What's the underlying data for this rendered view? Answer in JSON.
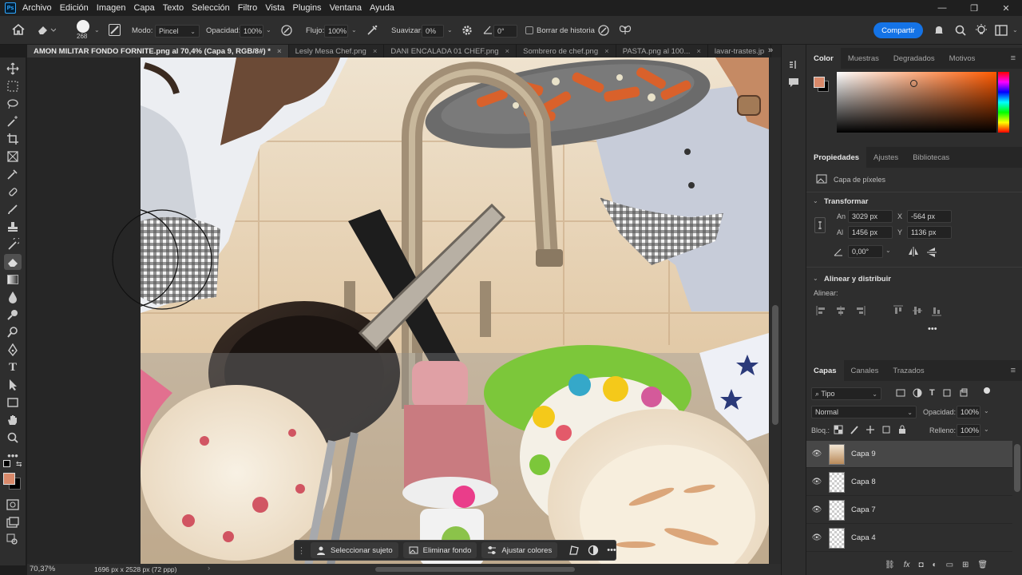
{
  "menu": {
    "items": [
      "Archivo",
      "Edición",
      "Imagen",
      "Capa",
      "Texto",
      "Selección",
      "Filtro",
      "Vista",
      "Plugins",
      "Ventana",
      "Ayuda"
    ]
  },
  "options": {
    "brush_size": "268",
    "mode_label": "Modo:",
    "mode_value": "Pincel",
    "opacity_label": "Opacidad:",
    "opacity_value": "100%",
    "flow_label": "Flujo:",
    "flow_value": "100%",
    "smooth_label": "Suavizar:",
    "smooth_value": "0%",
    "angle_value": "0°",
    "history_label": "Borrar de historia",
    "share_label": "Compartir"
  },
  "tabs": [
    {
      "label": "AMON MILITAR FONDO FORNITE.png al 70,4% (Capa 9, RGB/8#) *",
      "active": true
    },
    {
      "label": "Lesly Mesa Chef.png",
      "active": false
    },
    {
      "label": "DANI ENCALADA 01 CHEF.png",
      "active": false
    },
    {
      "label": "Sombrero de chef.png",
      "active": false
    },
    {
      "label": "PASTA.png al 100...",
      "active": false
    },
    {
      "label": "lavar-trastes.jp",
      "active": false
    }
  ],
  "context_bar": {
    "select_subject": "Seleccionar sujeto",
    "remove_bg": "Eliminar fondo",
    "adjust_colors": "Ajustar colores"
  },
  "status": {
    "zoom": "70,37%",
    "doc_info": "1696 px x 2528 px (72 ppp)"
  },
  "color_panel": {
    "tabs": [
      "Color",
      "Muestras",
      "Degradados",
      "Motivos"
    ],
    "foreground": "#d9896a",
    "background": "#000000"
  },
  "properties": {
    "tabs": [
      "Propiedades",
      "Ajustes",
      "Bibliotecas"
    ],
    "layer_kind": "Capa de píxeles",
    "transform_title": "Transformar",
    "w_label": "An",
    "w_value": "3029 px",
    "h_label": "Al",
    "h_value": "1456 px",
    "x_label": "X",
    "x_value": "-564 px",
    "y_label": "Y",
    "y_value": "1136 px",
    "angle_value": "0,00°",
    "align_title": "Alinear y distribuir",
    "align_label": "Alinear:"
  },
  "layers": {
    "tabs": [
      "Capas",
      "Canales",
      "Trazados"
    ],
    "filter_label": "Tipo",
    "blend_mode": "Normal",
    "opacity_label": "Opacidad:",
    "opacity_value": "100%",
    "lock_label": "Bloq.:",
    "fill_label": "Relleno:",
    "fill_value": "100%",
    "items": [
      {
        "name": "Capa 9",
        "selected": true
      },
      {
        "name": "Capa 8",
        "selected": false
      },
      {
        "name": "Capa 7",
        "selected": false
      },
      {
        "name": "Capa 4",
        "selected": false
      }
    ]
  }
}
